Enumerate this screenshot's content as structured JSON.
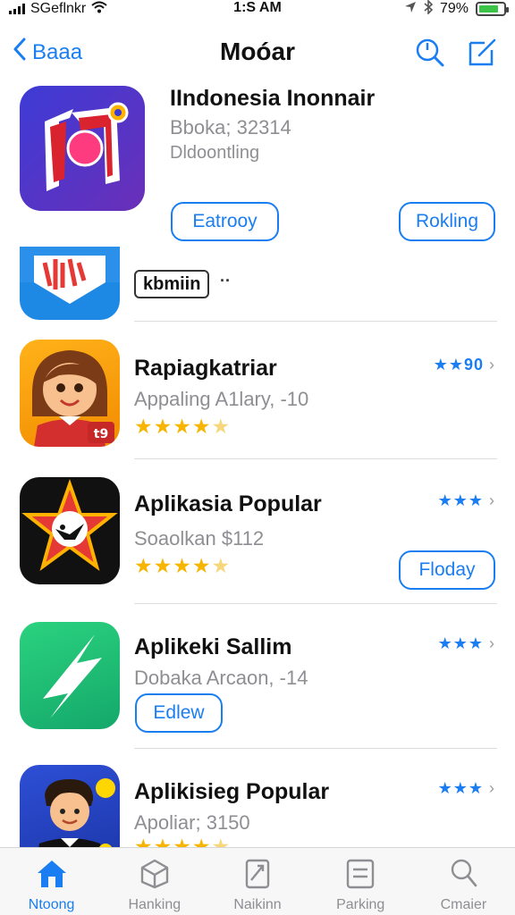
{
  "status_bar": {
    "carrier": "SGeflnkr",
    "time": "1:S AM",
    "battery": "79%",
    "battery_level": 0.79
  },
  "nav": {
    "back_label": "Baaa",
    "title": "Moóar"
  },
  "featured": {
    "name": "IIndonesia Inonnair",
    "subtitle": "Bboka; 32314",
    "category": "Dldoontling",
    "button_left": "Eatrooy",
    "button_right": "Rokling"
  },
  "promo": {
    "tag": "kbmiin",
    "dots": "··"
  },
  "apps": [
    {
      "name": "Rapiagkatriar",
      "subtitle": "Appaling A1lary, -10",
      "rating": "★★★★",
      "rank": "★★90"
    },
    {
      "name": "Aplikasia Popular",
      "subtitle": "Soaolkan $112",
      "rating": "★★★★",
      "rank": "★★★",
      "button": "Floday"
    },
    {
      "name": "Aplikeki Sallim",
      "subtitle": "Dobaka Arcaon, -14",
      "rank": "★★★",
      "button": "Edlew"
    },
    {
      "name": "Aplikisieg Popular",
      "subtitle": "Apoliar; 3150",
      "rating": "★★★★",
      "rank": "★★★"
    }
  ],
  "tabs": [
    {
      "label": "Ntoong",
      "icon": "home-icon"
    },
    {
      "label": "Hanking",
      "icon": "box-icon"
    },
    {
      "label": "Naikinn",
      "icon": "chart-icon"
    },
    {
      "label": "Parking",
      "icon": "list-icon"
    },
    {
      "label": "Cmaier",
      "icon": "search-icon"
    }
  ],
  "colors": {
    "accent": "#1a7ef2",
    "star": "#f7b500",
    "muted": "#8e8e93"
  }
}
